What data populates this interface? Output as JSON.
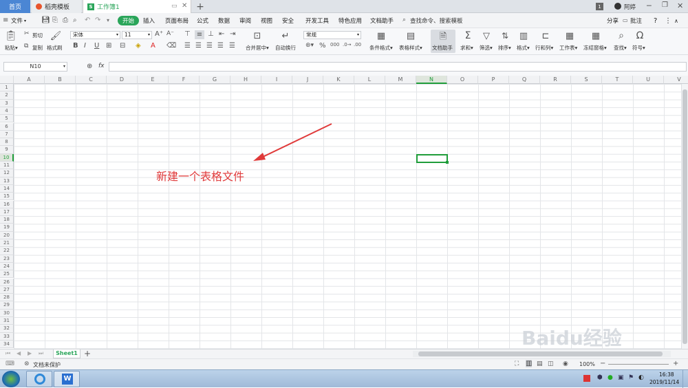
{
  "tabs": {
    "home": "首页",
    "template": "稻壳模板",
    "doc": "工作簿1",
    "doc_badge": "S",
    "new_tab": "+",
    "window_num": "1",
    "user": "阿婷"
  },
  "menu": {
    "file": "文件",
    "items": [
      "开始",
      "插入",
      "页面布局",
      "公式",
      "数据",
      "审阅",
      "视图",
      "安全",
      "开发工具",
      "特色应用",
      "文档助手"
    ],
    "search_placeholder": "查找命令、搜索模板",
    "share": "分享",
    "comment": "批注",
    "help": "?"
  },
  "ribbon": {
    "paste": "粘贴",
    "cut": "剪切",
    "copy": "复制",
    "format_painter": "格式刷",
    "font_name": "宋体",
    "font_size": "11",
    "merge_center": "合并居中",
    "wrap_text": "自动换行",
    "number_format": "常规",
    "cond_format": "条件格式",
    "table_style": "表格样式",
    "doc_helper": "文档助手",
    "sum": "求和",
    "filter": "筛选",
    "sort": "排序",
    "format": "格式",
    "row_col": "行和列",
    "worksheet": "工作表",
    "freeze": "冻结窗格",
    "find": "查找",
    "symbol": "符号"
  },
  "formula": {
    "name_box": "N10",
    "fx": "fx",
    "value": ""
  },
  "grid": {
    "columns": [
      "A",
      "B",
      "C",
      "D",
      "E",
      "F",
      "G",
      "H",
      "I",
      "J",
      "K",
      "L",
      "M",
      "N",
      "O",
      "P",
      "Q",
      "R",
      "S",
      "T",
      "U",
      "V"
    ],
    "rows": [
      "1",
      "2",
      "3",
      "4",
      "5",
      "6",
      "7",
      "8",
      "9",
      "10",
      "11",
      "12",
      "13",
      "14",
      "15",
      "16",
      "17",
      "18",
      "19",
      "20",
      "21",
      "22",
      "23",
      "24",
      "25",
      "26",
      "27",
      "28",
      "29",
      "30",
      "31",
      "32",
      "33",
      "34"
    ],
    "active_col": "N",
    "active_row": "10",
    "annotation": "新建一个表格文件"
  },
  "sheets": {
    "tabs": [
      "Sheet1"
    ],
    "add": "+"
  },
  "status": {
    "protect": "文档未保护",
    "zoom": "100%"
  },
  "taskbar": {
    "time": "16:38",
    "date": "2019/11/14"
  },
  "watermark": "Baidu经验",
  "colors": {
    "accent_green": "#2aa55a",
    "annotation_red": "#e03a3a",
    "selection_green": "#1f9d3a"
  }
}
